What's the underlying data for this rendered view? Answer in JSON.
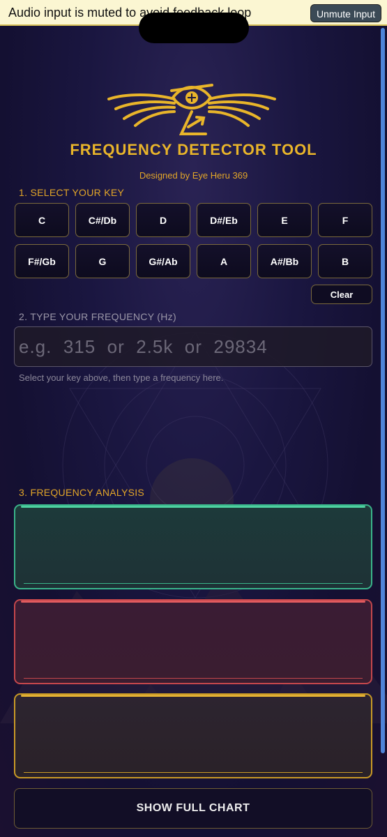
{
  "banner": {
    "message": "Audio input is muted to avoid feedback loop",
    "unmute_label": "Unmute Input"
  },
  "header": {
    "title": "FREQUENCY DETECTOR TOOL",
    "designer": "Designed by Eye Heru 369",
    "logo_icon": "winged-eye-logo-icon"
  },
  "section1": {
    "label": "1.  SELECT YOUR KEY",
    "keys": [
      "C",
      "C#/Db",
      "D",
      "D#/Eb",
      "E",
      "F",
      "F#/Gb",
      "G",
      "G#/Ab",
      "A",
      "A#/Bb",
      "B"
    ],
    "clear_label": "Clear"
  },
  "section2": {
    "label": "2.  TYPE YOUR FREQUENCY (Hz)",
    "placeholder": "e.g.  315  or  2.5k  or  29834",
    "value": "",
    "hint": "Select your key above, then type a frequency here."
  },
  "section3": {
    "label": "3.  FREQUENCY ANALYSIS",
    "panels": [
      "green",
      "red",
      "gold"
    ]
  },
  "footer": {
    "chart_button": "SHOW FULL CHART"
  },
  "colors": {
    "accent_gold": "#e3a628",
    "panel_green": "#3ab48a",
    "panel_red": "#c4474c",
    "panel_gold": "#c99a26"
  }
}
